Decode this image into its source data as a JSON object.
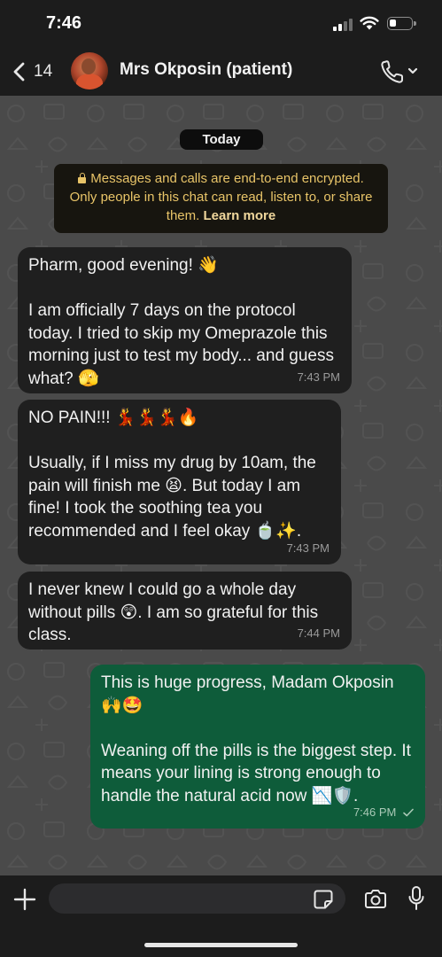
{
  "status_bar": {
    "time": "7:46"
  },
  "header": {
    "back_count": "14",
    "contact_name": "Mrs Okposin (patient)"
  },
  "chat": {
    "date_label": "Today",
    "encryption_notice": {
      "text": "Messages and calls are end-to-end encrypted. Only people in this chat can read, listen to, or share them.",
      "link": "Learn more"
    },
    "messages": [
      {
        "direction": "incoming",
        "text": "Pharm, good evening! 👋\n\nI am officially 7 days on the protocol today. I tried to skip my Omeprazole this morning just to test my body... and guess what? 🫣",
        "time": "7:43 PM"
      },
      {
        "direction": "incoming",
        "text": "NO PAIN!!! 💃💃💃🔥\n\nUsually, if I miss my drug by 10am, the pain will finish me 😫. But today I am fine! I took the soothing tea you recommended and I feel okay 🍵✨.",
        "time": "7:43 PM"
      },
      {
        "direction": "incoming",
        "text": "I never knew I could go a whole day without pills 😲. I am so grateful for this class.",
        "time": "7:44 PM"
      },
      {
        "direction": "outgoing",
        "text": "This is huge progress, Madam Okposin 🙌🤩\n\nWeaning off the pills is the biggest step. It means your lining is strong enough to handle the natural acid now 📉🛡️.",
        "time": "7:46 PM",
        "status": "sent"
      }
    ]
  },
  "input": {
    "placeholder": ""
  },
  "colors": {
    "incoming_bubble": "#1f1f1f",
    "outgoing_bubble": "#0e5c3a",
    "notice_text": "#e8c468",
    "chat_background": "#4a4a4a"
  },
  "icons": [
    "back-chevron-icon",
    "call-icon",
    "lock-icon",
    "plus-icon",
    "sticker-icon",
    "camera-icon",
    "mic-icon",
    "wifi-icon",
    "signal-icon",
    "battery-icon"
  ]
}
